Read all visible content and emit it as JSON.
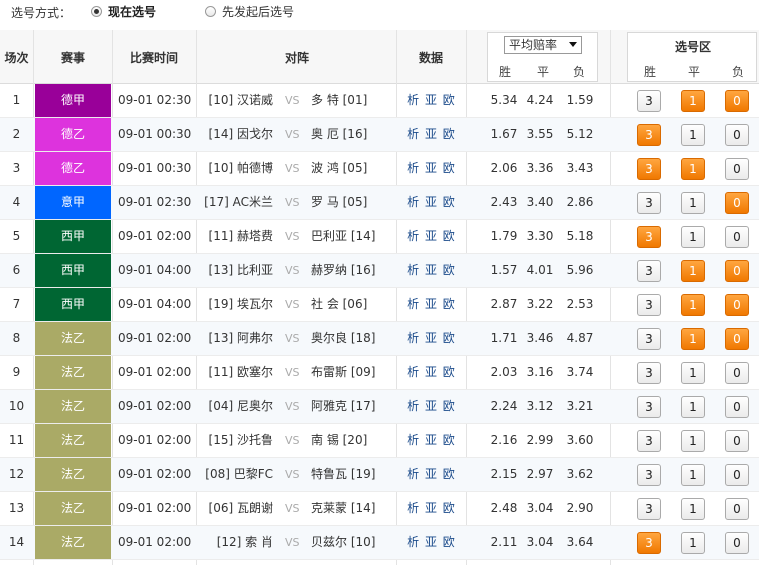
{
  "selection_mode": {
    "label": "选号方式：",
    "options": [
      {
        "label": "现在选号",
        "checked": true
      },
      {
        "label": "先发起后选号",
        "checked": false
      }
    ]
  },
  "headers": {
    "index": "场次",
    "league": "赛事",
    "time": "比赛时间",
    "match": "对阵",
    "data": "数据",
    "odds_select": "平均赔率",
    "pick_zone": "选号区",
    "win": "胜",
    "draw": "平",
    "lose": "负"
  },
  "colors": {
    "德甲": "#990099",
    "德乙": "#dd33dd",
    "意甲": "#0066ff",
    "西甲": "#006633",
    "法乙": "#aaaa66",
    "selected": "#f07800"
  },
  "rows": [
    {
      "idx": "1",
      "league": "德甲",
      "time": "09-01 02:30",
      "home": "[10] 汉诺威",
      "away": "多 特 [01]",
      "links": "析 亚 欧",
      "odds": [
        "5.34",
        "4.24",
        "1.59"
      ],
      "picks": [
        false,
        true,
        true
      ]
    },
    {
      "idx": "2",
      "league": "德乙",
      "time": "09-01 00:30",
      "home": "[14] 因戈尔",
      "away": "奥 厄 [16]",
      "links": "析 亚 欧",
      "odds": [
        "1.67",
        "3.55",
        "5.12"
      ],
      "picks": [
        true,
        false,
        false
      ]
    },
    {
      "idx": "3",
      "league": "德乙",
      "time": "09-01 00:30",
      "home": "[10] 帕德博",
      "away": "波 鸿 [05]",
      "links": "析 亚 欧",
      "odds": [
        "2.06",
        "3.36",
        "3.43"
      ],
      "picks": [
        true,
        true,
        false
      ]
    },
    {
      "idx": "4",
      "league": "意甲",
      "time": "09-01 02:30",
      "home": "[17] AC米兰",
      "away": "罗 马 [05]",
      "links": "析 亚 欧",
      "odds": [
        "2.43",
        "3.40",
        "2.86"
      ],
      "picks": [
        false,
        false,
        true
      ]
    },
    {
      "idx": "5",
      "league": "西甲",
      "time": "09-01 02:00",
      "home": "[11] 赫塔费",
      "away": "巴利亚 [14]",
      "links": "析 亚 欧",
      "odds": [
        "1.79",
        "3.30",
        "5.18"
      ],
      "picks": [
        true,
        false,
        false
      ]
    },
    {
      "idx": "6",
      "league": "西甲",
      "time": "09-01 04:00",
      "home": "[13] 比利亚",
      "away": "赫罗纳 [16]",
      "links": "析 亚 欧",
      "odds": [
        "1.57",
        "4.01",
        "5.96"
      ],
      "picks": [
        false,
        true,
        true
      ]
    },
    {
      "idx": "7",
      "league": "西甲",
      "time": "09-01 04:00",
      "home": "[19] 埃瓦尔",
      "away": "社 会 [06]",
      "links": "析 亚 欧",
      "odds": [
        "2.87",
        "3.22",
        "2.53"
      ],
      "picks": [
        false,
        true,
        true
      ]
    },
    {
      "idx": "8",
      "league": "法乙",
      "time": "09-01 02:00",
      "home": "[13] 阿弗尔",
      "away": "奥尔良 [18]",
      "links": "析 亚 欧",
      "odds": [
        "1.71",
        "3.46",
        "4.87"
      ],
      "picks": [
        false,
        true,
        true
      ]
    },
    {
      "idx": "9",
      "league": "法乙",
      "time": "09-01 02:00",
      "home": "[11] 欧塞尔",
      "away": "布雷斯 [09]",
      "links": "析 亚 欧",
      "odds": [
        "2.03",
        "3.16",
        "3.74"
      ],
      "picks": [
        false,
        false,
        false
      ]
    },
    {
      "idx": "10",
      "league": "法乙",
      "time": "09-01 02:00",
      "home": "[04] 尼奥尔",
      "away": "阿雅克 [17]",
      "links": "析 亚 欧",
      "odds": [
        "2.24",
        "3.12",
        "3.21"
      ],
      "picks": [
        false,
        false,
        false
      ]
    },
    {
      "idx": "11",
      "league": "法乙",
      "time": "09-01 02:00",
      "home": "[15] 沙托鲁",
      "away": "南 锡 [20]",
      "links": "析 亚 欧",
      "odds": [
        "2.16",
        "2.99",
        "3.60"
      ],
      "picks": [
        false,
        false,
        false
      ]
    },
    {
      "idx": "12",
      "league": "法乙",
      "time": "09-01 02:00",
      "home": "[08] 巴黎FC",
      "away": "特鲁瓦 [19]",
      "links": "析 亚 欧",
      "odds": [
        "2.15",
        "2.97",
        "3.62"
      ],
      "picks": [
        false,
        false,
        false
      ]
    },
    {
      "idx": "13",
      "league": "法乙",
      "time": "09-01 02:00",
      "home": "[06] 瓦朗谢",
      "away": "克莱蒙 [14]",
      "links": "析 亚 欧",
      "odds": [
        "2.48",
        "3.04",
        "2.90"
      ],
      "picks": [
        false,
        false,
        false
      ]
    },
    {
      "idx": "14",
      "league": "法乙",
      "time": "09-01 02:00",
      "home": "[12] 索 肖",
      "away": "贝兹尔 [10]",
      "links": "析 亚 欧",
      "odds": [
        "2.11",
        "3.04",
        "3.64"
      ],
      "picks": [
        true,
        false,
        false
      ]
    }
  ],
  "pick_values": [
    "3",
    "1",
    "0"
  ],
  "vs_text": "VS"
}
